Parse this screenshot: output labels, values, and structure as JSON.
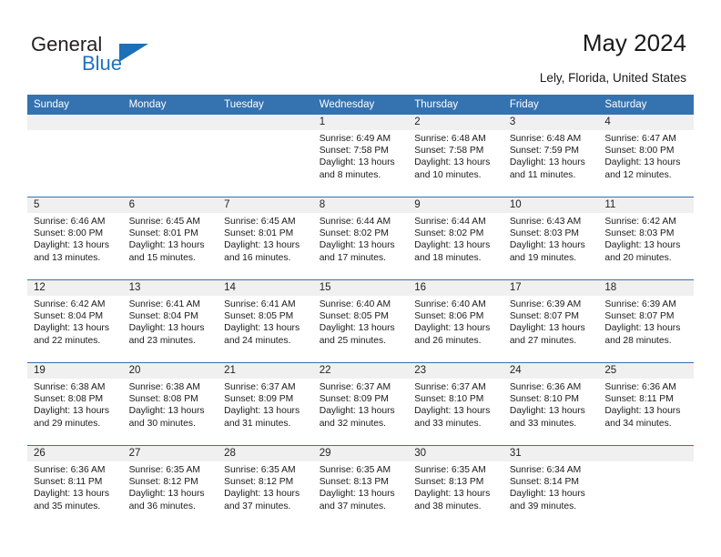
{
  "brand": {
    "name_part1": "General",
    "name_part2": "Blue",
    "accent_color": "#1d6fb8"
  },
  "header": {
    "title": "May 2024",
    "subtitle": "Lely, Florida, United States"
  },
  "calendar": {
    "header_bg": "#3572b0",
    "daynum_bg": "#f0f0f0",
    "weekday_headers": [
      "Sunday",
      "Monday",
      "Tuesday",
      "Wednesday",
      "Thursday",
      "Friday",
      "Saturday"
    ],
    "weeks": [
      [
        {
          "day": "",
          "sunrise": "",
          "sunset": "",
          "daylight_line1": "",
          "daylight_line2": ""
        },
        {
          "day": "",
          "sunrise": "",
          "sunset": "",
          "daylight_line1": "",
          "daylight_line2": ""
        },
        {
          "day": "",
          "sunrise": "",
          "sunset": "",
          "daylight_line1": "",
          "daylight_line2": ""
        },
        {
          "day": "1",
          "sunrise": "Sunrise: 6:49 AM",
          "sunset": "Sunset: 7:58 PM",
          "daylight_line1": "Daylight: 13 hours",
          "daylight_line2": "and 8 minutes."
        },
        {
          "day": "2",
          "sunrise": "Sunrise: 6:48 AM",
          "sunset": "Sunset: 7:58 PM",
          "daylight_line1": "Daylight: 13 hours",
          "daylight_line2": "and 10 minutes."
        },
        {
          "day": "3",
          "sunrise": "Sunrise: 6:48 AM",
          "sunset": "Sunset: 7:59 PM",
          "daylight_line1": "Daylight: 13 hours",
          "daylight_line2": "and 11 minutes."
        },
        {
          "day": "4",
          "sunrise": "Sunrise: 6:47 AM",
          "sunset": "Sunset: 8:00 PM",
          "daylight_line1": "Daylight: 13 hours",
          "daylight_line2": "and 12 minutes."
        }
      ],
      [
        {
          "day": "5",
          "sunrise": "Sunrise: 6:46 AM",
          "sunset": "Sunset: 8:00 PM",
          "daylight_line1": "Daylight: 13 hours",
          "daylight_line2": "and 13 minutes."
        },
        {
          "day": "6",
          "sunrise": "Sunrise: 6:45 AM",
          "sunset": "Sunset: 8:01 PM",
          "daylight_line1": "Daylight: 13 hours",
          "daylight_line2": "and 15 minutes."
        },
        {
          "day": "7",
          "sunrise": "Sunrise: 6:45 AM",
          "sunset": "Sunset: 8:01 PM",
          "daylight_line1": "Daylight: 13 hours",
          "daylight_line2": "and 16 minutes."
        },
        {
          "day": "8",
          "sunrise": "Sunrise: 6:44 AM",
          "sunset": "Sunset: 8:02 PM",
          "daylight_line1": "Daylight: 13 hours",
          "daylight_line2": "and 17 minutes."
        },
        {
          "day": "9",
          "sunrise": "Sunrise: 6:44 AM",
          "sunset": "Sunset: 8:02 PM",
          "daylight_line1": "Daylight: 13 hours",
          "daylight_line2": "and 18 minutes."
        },
        {
          "day": "10",
          "sunrise": "Sunrise: 6:43 AM",
          "sunset": "Sunset: 8:03 PM",
          "daylight_line1": "Daylight: 13 hours",
          "daylight_line2": "and 19 minutes."
        },
        {
          "day": "11",
          "sunrise": "Sunrise: 6:42 AM",
          "sunset": "Sunset: 8:03 PM",
          "daylight_line1": "Daylight: 13 hours",
          "daylight_line2": "and 20 minutes."
        }
      ],
      [
        {
          "day": "12",
          "sunrise": "Sunrise: 6:42 AM",
          "sunset": "Sunset: 8:04 PM",
          "daylight_line1": "Daylight: 13 hours",
          "daylight_line2": "and 22 minutes."
        },
        {
          "day": "13",
          "sunrise": "Sunrise: 6:41 AM",
          "sunset": "Sunset: 8:04 PM",
          "daylight_line1": "Daylight: 13 hours",
          "daylight_line2": "and 23 minutes."
        },
        {
          "day": "14",
          "sunrise": "Sunrise: 6:41 AM",
          "sunset": "Sunset: 8:05 PM",
          "daylight_line1": "Daylight: 13 hours",
          "daylight_line2": "and 24 minutes."
        },
        {
          "day": "15",
          "sunrise": "Sunrise: 6:40 AM",
          "sunset": "Sunset: 8:05 PM",
          "daylight_line1": "Daylight: 13 hours",
          "daylight_line2": "and 25 minutes."
        },
        {
          "day": "16",
          "sunrise": "Sunrise: 6:40 AM",
          "sunset": "Sunset: 8:06 PM",
          "daylight_line1": "Daylight: 13 hours",
          "daylight_line2": "and 26 minutes."
        },
        {
          "day": "17",
          "sunrise": "Sunrise: 6:39 AM",
          "sunset": "Sunset: 8:07 PM",
          "daylight_line1": "Daylight: 13 hours",
          "daylight_line2": "and 27 minutes."
        },
        {
          "day": "18",
          "sunrise": "Sunrise: 6:39 AM",
          "sunset": "Sunset: 8:07 PM",
          "daylight_line1": "Daylight: 13 hours",
          "daylight_line2": "and 28 minutes."
        }
      ],
      [
        {
          "day": "19",
          "sunrise": "Sunrise: 6:38 AM",
          "sunset": "Sunset: 8:08 PM",
          "daylight_line1": "Daylight: 13 hours",
          "daylight_line2": "and 29 minutes."
        },
        {
          "day": "20",
          "sunrise": "Sunrise: 6:38 AM",
          "sunset": "Sunset: 8:08 PM",
          "daylight_line1": "Daylight: 13 hours",
          "daylight_line2": "and 30 minutes."
        },
        {
          "day": "21",
          "sunrise": "Sunrise: 6:37 AM",
          "sunset": "Sunset: 8:09 PM",
          "daylight_line1": "Daylight: 13 hours",
          "daylight_line2": "and 31 minutes."
        },
        {
          "day": "22",
          "sunrise": "Sunrise: 6:37 AM",
          "sunset": "Sunset: 8:09 PM",
          "daylight_line1": "Daylight: 13 hours",
          "daylight_line2": "and 32 minutes."
        },
        {
          "day": "23",
          "sunrise": "Sunrise: 6:37 AM",
          "sunset": "Sunset: 8:10 PM",
          "daylight_line1": "Daylight: 13 hours",
          "daylight_line2": "and 33 minutes."
        },
        {
          "day": "24",
          "sunrise": "Sunrise: 6:36 AM",
          "sunset": "Sunset: 8:10 PM",
          "daylight_line1": "Daylight: 13 hours",
          "daylight_line2": "and 33 minutes."
        },
        {
          "day": "25",
          "sunrise": "Sunrise: 6:36 AM",
          "sunset": "Sunset: 8:11 PM",
          "daylight_line1": "Daylight: 13 hours",
          "daylight_line2": "and 34 minutes."
        }
      ],
      [
        {
          "day": "26",
          "sunrise": "Sunrise: 6:36 AM",
          "sunset": "Sunset: 8:11 PM",
          "daylight_line1": "Daylight: 13 hours",
          "daylight_line2": "and 35 minutes."
        },
        {
          "day": "27",
          "sunrise": "Sunrise: 6:35 AM",
          "sunset": "Sunset: 8:12 PM",
          "daylight_line1": "Daylight: 13 hours",
          "daylight_line2": "and 36 minutes."
        },
        {
          "day": "28",
          "sunrise": "Sunrise: 6:35 AM",
          "sunset": "Sunset: 8:12 PM",
          "daylight_line1": "Daylight: 13 hours",
          "daylight_line2": "and 37 minutes."
        },
        {
          "day": "29",
          "sunrise": "Sunrise: 6:35 AM",
          "sunset": "Sunset: 8:13 PM",
          "daylight_line1": "Daylight: 13 hours",
          "daylight_line2": "and 37 minutes."
        },
        {
          "day": "30",
          "sunrise": "Sunrise: 6:35 AM",
          "sunset": "Sunset: 8:13 PM",
          "daylight_line1": "Daylight: 13 hours",
          "daylight_line2": "and 38 minutes."
        },
        {
          "day": "31",
          "sunrise": "Sunrise: 6:34 AM",
          "sunset": "Sunset: 8:14 PM",
          "daylight_line1": "Daylight: 13 hours",
          "daylight_line2": "and 39 minutes."
        },
        {
          "day": "",
          "sunrise": "",
          "sunset": "",
          "daylight_line1": "",
          "daylight_line2": ""
        }
      ]
    ]
  }
}
